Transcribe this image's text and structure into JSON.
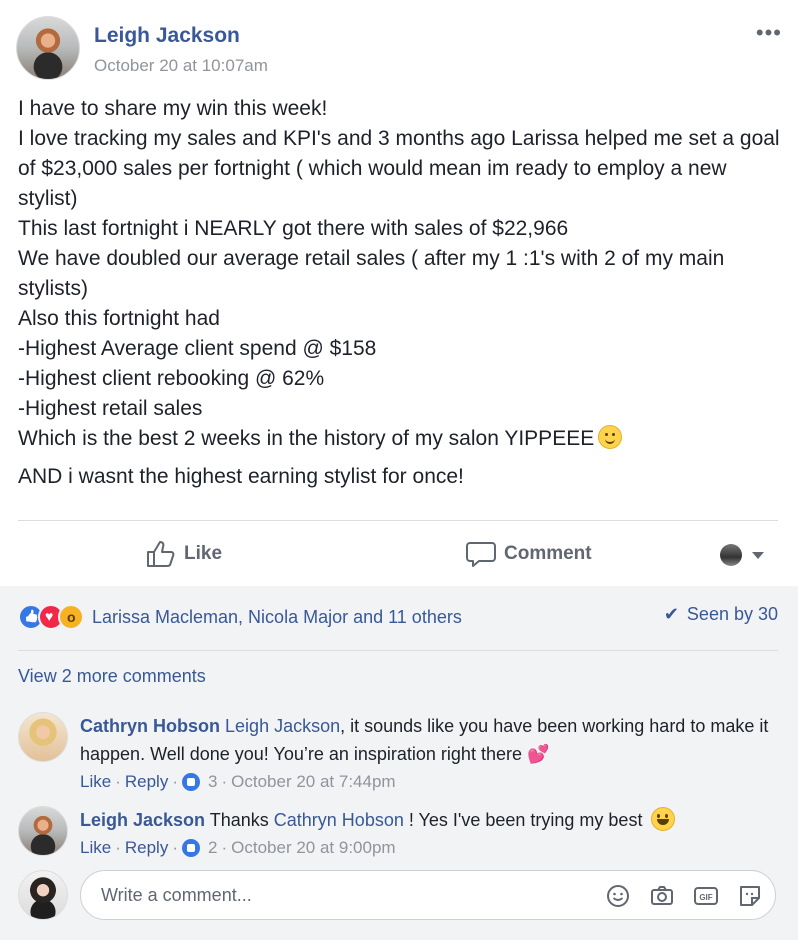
{
  "post": {
    "author": "Leigh Jackson",
    "timestamp": "October 20 at 10:07am",
    "more_label": "•••",
    "lines": [
      "I have to share my win this week!",
      "I love tracking my sales and KPI's and 3 months ago Larissa helped me set a goal of $23,000 sales per fortnight ( which would mean im ready to employ a new stylist)",
      "This last fortnight i NEARLY got there with sales of $22,966",
      "We have doubled our average retail sales ( after my 1 :1's with 2 of my main stylists)",
      "Also this fortnight had",
      "-Highest Average client spend @ $158",
      "-Highest client rebooking @ 62%",
      "-Highest retail sales",
      "Which is the best 2 weeks in the history of my salon YIPPEEE"
    ],
    "last_line": "AND i wasnt the highest earning stylist for once!"
  },
  "actions": {
    "like_label": "Like",
    "comment_label": "Comment"
  },
  "reactions": {
    "summary": "Larissa Macleman, Nicola Major and 11 others",
    "seen_label": "Seen by 30",
    "types": [
      "like",
      "love",
      "wow"
    ]
  },
  "comments": {
    "view_more": "View 2 more comments",
    "items": [
      {
        "author": "Cathryn Hobson",
        "mention": "Leigh Jackson",
        "text": ", it sounds like you have been working hard to make it happen. Well done you! You’re an inspiration right there",
        "like_label": "Like",
        "reply_label": "Reply",
        "like_count": "3",
        "time": "October 20 at 7:44pm"
      },
      {
        "author": "Leigh Jackson",
        "text_before": "Thanks",
        "mention": "Cathryn Hobson",
        "text_after": "! Yes I've been trying my best",
        "like_label": "Like",
        "reply_label": "Reply",
        "like_count": "2",
        "time": "October 20 at 9:00pm"
      }
    ]
  },
  "composer": {
    "placeholder": "Write a comment...",
    "icons": [
      "emoji-icon",
      "camera-icon",
      "gif-icon",
      "sticker-icon"
    ]
  },
  "colors": {
    "link": "#385898",
    "meta": "#90949c",
    "background_footer": "#f2f3f5",
    "like_blue": "#3578e5"
  }
}
